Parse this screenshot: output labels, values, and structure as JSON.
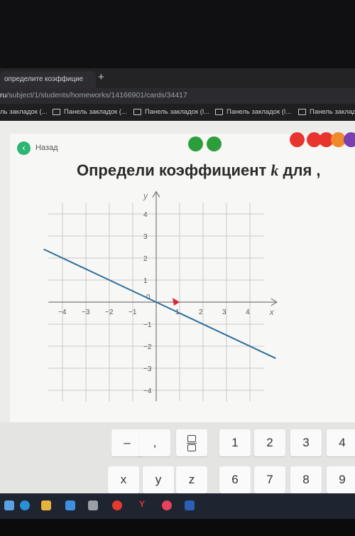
{
  "browser": {
    "tab_title": "определите коэффицие",
    "new_tab": "+",
    "url_domain": "ru",
    "url_path": "/subject/1/students/homeworks/14166901/cards/34417",
    "bookmarks": [
      "ль закладок (...",
      "Панель закладок (...",
      "Панель закладок (l...",
      "Панель закладок (l...",
      "Панель заклад"
    ]
  },
  "page": {
    "back_label": "Назад",
    "title": "Определи коэффициент ",
    "title_var": "k",
    "title_tail": " для ,",
    "progress_colors": [
      "#2e9e3c",
      "#2e9e3c",
      "#e8342e",
      "#e8342e",
      "#e8342e",
      "#ef8a2a",
      "#7a3fb0"
    ]
  },
  "chart_data": {
    "type": "line",
    "xlabel": "x",
    "ylabel": "y",
    "xlim": [
      -4.6,
      4.6
    ],
    "ylim": [
      -4.5,
      4.5
    ],
    "grid": true,
    "x_ticks": [
      -4,
      -3,
      -2,
      -1,
      1,
      2,
      3,
      4
    ],
    "y_ticks": [
      -4,
      -3,
      -2,
      -1,
      1,
      2,
      3,
      4
    ],
    "origin_label": "0",
    "series": [
      {
        "x": [
          -4.8,
          5.1
        ],
        "y": [
          2.4,
          -2.55
        ]
      }
    ],
    "marker": {
      "x": 1,
      "y": 0
    },
    "line_color": "#2f6f9a",
    "marker_color": "#e0243a"
  },
  "keypad": {
    "row1": [
      "–",
      ",",
      "frac",
      "1",
      "2",
      "3",
      "4"
    ],
    "row2": [
      "x",
      "y",
      "z",
      "6",
      "7",
      "8",
      "9"
    ]
  }
}
